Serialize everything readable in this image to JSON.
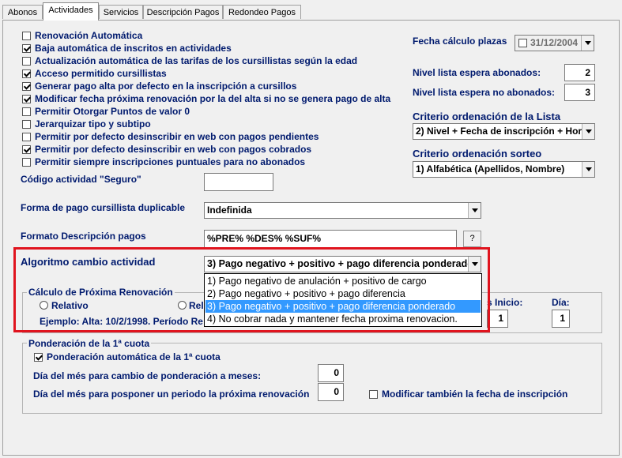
{
  "tabs": [
    "Abonos",
    "Actividades",
    "Servicios",
    "Descripción Pagos",
    "Redondeo Pagos"
  ],
  "checkboxes": [
    {
      "label": "Renovación Automática",
      "checked": false
    },
    {
      "label": "Baja automática de inscritos en actividades",
      "checked": true
    },
    {
      "label": "Actualización automática de las tarifas de los cursillistas según la edad",
      "checked": false
    },
    {
      "label": "Acceso permitido cursillistas",
      "checked": true
    },
    {
      "label": "Generar pago alta por defecto en la inscripción a cursillos",
      "checked": true
    },
    {
      "label": "Modificar fecha próxima renovación por la del alta si no se genera pago de alta",
      "checked": true
    },
    {
      "label": "Permitir Otorgar Puntos de valor 0",
      "checked": false
    },
    {
      "label": "Jerarquizar tipo y subtipo",
      "checked": false
    },
    {
      "label": "Permitir por defecto desinscribir en web con pagos pendientes",
      "checked": false
    },
    {
      "label": "Permitir por defecto desinscribir en web con pagos cobrados",
      "checked": true
    },
    {
      "label": "Permitir siempre inscripciones puntuales para no abonados",
      "checked": false
    }
  ],
  "right": {
    "fecha_label": "Fecha cálculo plazas",
    "fecha_value": "31/12/2004",
    "nivel_abonados_label": "Nivel lista espera abonados:",
    "nivel_abonados_value": "2",
    "nivel_no_abonados_label": "Nivel lista espera no abonados:",
    "nivel_no_abonados_value": "3",
    "criterio_lista_label": "Criterio ordenación de la Lista",
    "criterio_lista_value": "2) Nivel + Fecha de inscripción + Hora",
    "criterio_sorteo_label": "Criterio ordenación sorteo",
    "criterio_sorteo_value": "1) Alfabética (Apellidos, Nombre)"
  },
  "form": {
    "codigo_label": "Código actividad \"Seguro\"",
    "codigo_value": "",
    "forma_label": "Forma de pago cursillista duplicable",
    "forma_value": "Indefinida",
    "formato_label": "Formato Descripción pagos",
    "formato_value": "%PRE% %DES% %SUF%",
    "help_label": "?"
  },
  "algoritmo": {
    "label": "Algoritmo cambio actividad",
    "value": "3) Pago negativo + positivo + pago diferencia ponderado",
    "options": [
      "1) Pago negativo de anulación + positivo de cargo",
      "2) Pago negativo + positivo + pago diferencia",
      "3) Pago negativo + positivo + pago diferencia ponderado",
      "4) No cobrar nada y mantener fecha proxima renovacion."
    ],
    "selected_index": 2
  },
  "renovacion": {
    "title": "Cálculo de Próxima Renovación",
    "relativo": "Relativo",
    "rel2": "Rel",
    "ejemplo": "Ejemplo:  Alta:  10/2/1998.  Período Re",
    "meses_inicio_label": "s Inicio:",
    "meses_inicio_value": "1",
    "dia_label": "Día:",
    "dia_value": "1"
  },
  "ponderacion": {
    "title": "Ponderación de la 1ª cuota",
    "auto_label": "Ponderación automática de la 1ª cuota",
    "auto_checked": true,
    "dia_meses_label": "Día del més para cambio de ponderación a meses:",
    "dia_meses_value": "0",
    "dia_posponer_label": "Día del més para posponer un periodo la próxima renovación",
    "dia_posponer_value": "0",
    "modificar_label": "Modificar también la fecha de inscripción",
    "modificar_checked": false
  }
}
